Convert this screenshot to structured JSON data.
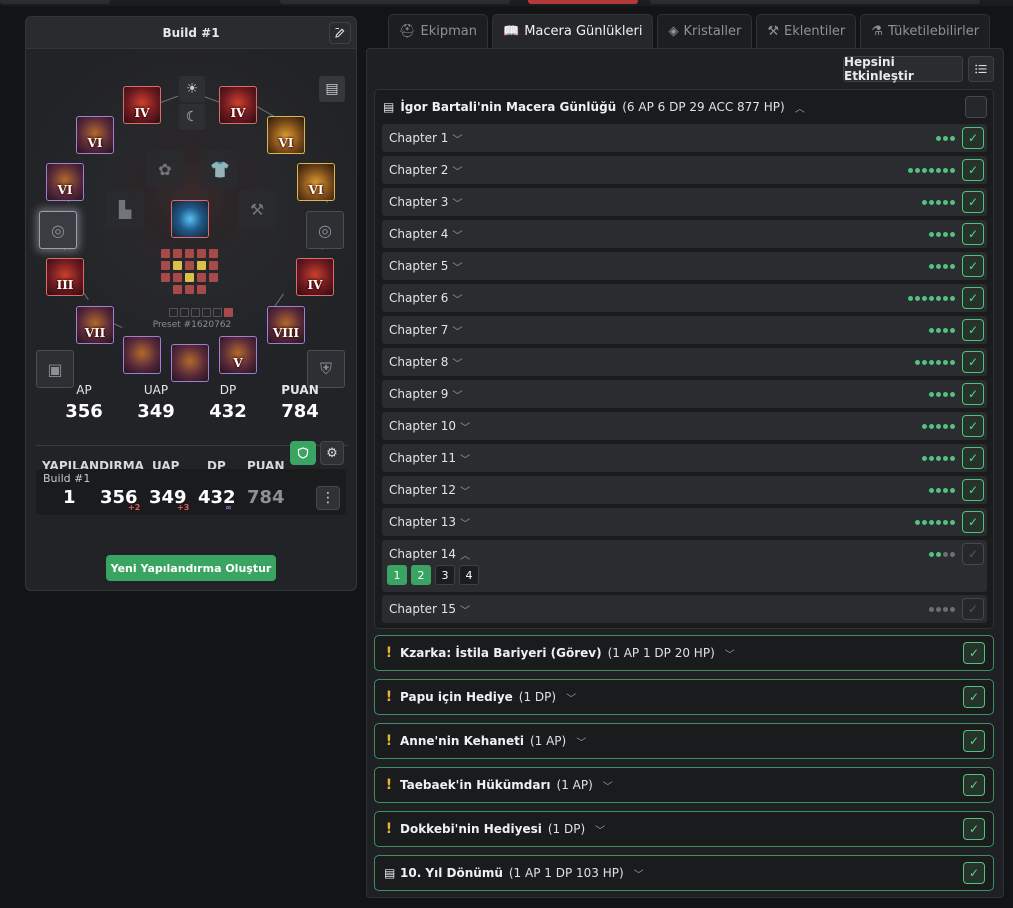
{
  "left": {
    "build_title": "Build #1",
    "preset_label": "Preset #1620762",
    "slots": [
      {
        "name": "gear-slot-top-left",
        "roman": "IV",
        "tier": "red"
      },
      {
        "name": "gear-slot-top-right",
        "roman": "IV",
        "tier": "red"
      },
      {
        "name": "gear-slot-ring-left",
        "roman": "VI",
        "tier": "purple"
      },
      {
        "name": "gear-slot-ring-right",
        "roman": "VI",
        "tier": "gold"
      },
      {
        "name": "gear-slot-earring-left",
        "roman": "VI",
        "tier": "purple"
      },
      {
        "name": "gear-slot-earring-right",
        "roman": "VI",
        "tier": "gold"
      },
      {
        "name": "gear-slot-weapon-left",
        "roman": "III",
        "tier": "red"
      },
      {
        "name": "gear-slot-weapon-right",
        "roman": "IV",
        "tier": "red"
      },
      {
        "name": "gear-slot-belt-left",
        "roman": "VII",
        "tier": "purple"
      },
      {
        "name": "gear-slot-belt-right",
        "roman": "VIII",
        "tier": "purple"
      },
      {
        "name": "gear-slot-bottom-right",
        "roman": "V",
        "tier": "purple"
      }
    ],
    "stats": [
      {
        "label": "AP",
        "value": "356"
      },
      {
        "label": "UAP",
        "value": "349"
      },
      {
        "label": "DP",
        "value": "432"
      },
      {
        "label": "PUAN",
        "value": "784"
      }
    ],
    "config_headers": [
      "YAPILANDIRMA",
      "UAP",
      "DP",
      "PUAN"
    ],
    "build_row": {
      "name": "Build #1",
      "index": "1",
      "ap": "356",
      "ap_delta": "+2",
      "uap": "349",
      "uap_delta": "+3",
      "dp": "432",
      "dp_delta": "∞",
      "points": "784"
    },
    "new_button": "Yeni Yapılandırma Oluştur"
  },
  "tabs": [
    {
      "label": "Ekipman",
      "icon": "helmet-icon",
      "active": false
    },
    {
      "label": "Macera Günlükleri",
      "icon": "book-icon",
      "active": true
    },
    {
      "label": "Kristaller",
      "icon": "crystal-icon",
      "active": false
    },
    {
      "label": "Eklentiler",
      "icon": "tools-icon",
      "active": false
    },
    {
      "label": "Tüketilebilirler",
      "icon": "potion-icon",
      "active": false
    }
  ],
  "enable_all": "Hepsini Etkinleştir",
  "journal": {
    "title": "İgor Bartali'nin Macera Günlüğü",
    "meta": "(6 AP 6 DP 29 ACC 877 HP)",
    "chapters": [
      {
        "label": "Chapter 1",
        "dots": 3,
        "done": 3,
        "checked": true
      },
      {
        "label": "Chapter 2",
        "dots": 7,
        "done": 7,
        "checked": true
      },
      {
        "label": "Chapter 3",
        "dots": 5,
        "done": 5,
        "checked": true
      },
      {
        "label": "Chapter 4",
        "dots": 4,
        "done": 4,
        "checked": true
      },
      {
        "label": "Chapter 5",
        "dots": 4,
        "done": 4,
        "checked": true
      },
      {
        "label": "Chapter 6",
        "dots": 7,
        "done": 7,
        "checked": true
      },
      {
        "label": "Chapter 7",
        "dots": 4,
        "done": 4,
        "checked": true
      },
      {
        "label": "Chapter 8",
        "dots": 6,
        "done": 6,
        "checked": true
      },
      {
        "label": "Chapter 9",
        "dots": 4,
        "done": 4,
        "checked": true
      },
      {
        "label": "Chapter 10",
        "dots": 5,
        "done": 5,
        "checked": true
      },
      {
        "label": "Chapter 11",
        "dots": 5,
        "done": 5,
        "checked": true
      },
      {
        "label": "Chapter 12",
        "dots": 4,
        "done": 4,
        "checked": true
      },
      {
        "label": "Chapter 13",
        "dots": 6,
        "done": 6,
        "checked": true
      },
      {
        "label": "Chapter 14",
        "dots": 4,
        "done": 2,
        "checked": false,
        "expanded": true,
        "pages": [
          "1",
          "2",
          "3",
          "4"
        ],
        "pages_done": 2
      },
      {
        "label": "Chapter 15",
        "dots": 4,
        "done": 0,
        "checked": false
      }
    ]
  },
  "quests": [
    {
      "name": "Kzarka: İstila Bariyeri (Görev)",
      "meta": "(1 AP 1 DP 20 HP)",
      "icon": "exclamation-icon"
    },
    {
      "name": "Papu için Hediye",
      "meta": "(1 DP)",
      "icon": "exclamation-icon"
    },
    {
      "name": "Anne'nin Kehaneti",
      "meta": "(1 AP)",
      "icon": "exclamation-icon"
    },
    {
      "name": "Taebaek'in Hükümdarı",
      "meta": "(1 AP)",
      "icon": "exclamation-icon"
    },
    {
      "name": "Dokkebi'nin Hediyesi",
      "meta": "(1 DP)",
      "icon": "exclamation-icon"
    },
    {
      "name": "10. Yıl Dönümü",
      "meta": "(1 AP 1 DP 103 HP)",
      "icon": "book-icon"
    }
  ],
  "colors": {
    "accent_green": "#3aa462",
    "check_green": "#5fd48b",
    "quest_exclaim": "#e6b23a",
    "red_tier": "#e06a6a",
    "purple_tier": "#a07ed6"
  }
}
